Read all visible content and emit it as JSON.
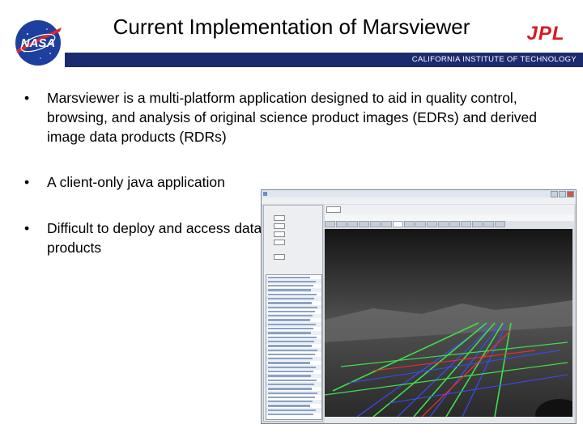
{
  "header": {
    "title": "Current Implementation of Marsviewer",
    "institution": "CALIFORNIA INSTITUTE OF TECHNOLOGY",
    "logos": {
      "left": "nasa-meatball-logo",
      "right": "jpl-logo"
    },
    "bar_color": "#1c2b6e"
  },
  "bullets": [
    {
      "text": "Marsviewer is a multi-platform application designed to aid in quality control, browsing, and analysis of original science product images (EDRs) and derived image data products (RDRs)"
    },
    {
      "text": "A client-only java application"
    },
    {
      "text": "Difficult to deploy and access data products"
    }
  ],
  "screenshot": {
    "description": "Marsviewer application window showing a grayscale Mars surface image with colored overlay grid lines",
    "overlay_colors": {
      "green": "#3fe04a",
      "blue": "#3a4bff",
      "red": "#ff2a2a"
    }
  }
}
